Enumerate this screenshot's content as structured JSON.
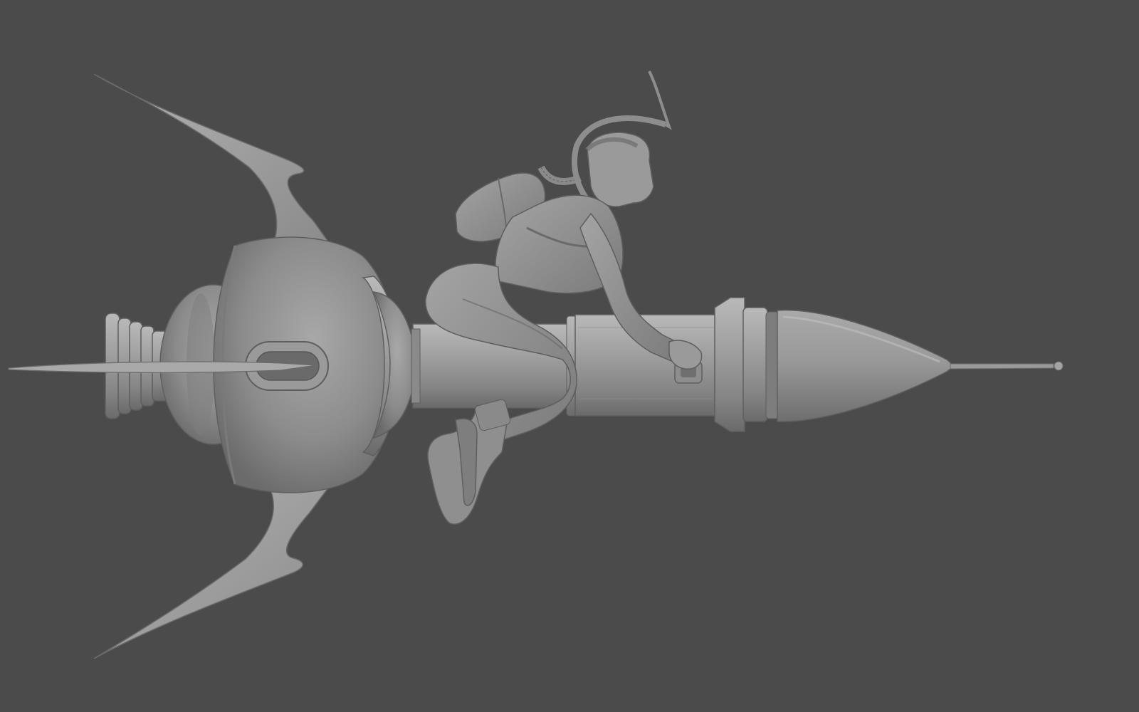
{
  "viewport": {
    "background": "#4b4b4b",
    "render_style": "untextured grey clay sculpt"
  },
  "subject": {
    "rocket": {
      "base_color": "#8e8e8e",
      "highlight_color": "#b7b7b7",
      "shadow_color": "#5f5f5f"
    },
    "rider": {
      "base_color": "#8a8a8a"
    }
  }
}
